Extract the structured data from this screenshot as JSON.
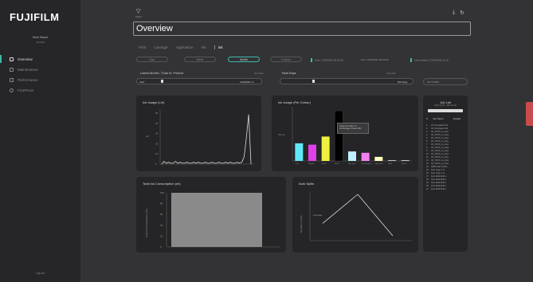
{
  "sidebar": {
    "logo": "FUJIFILM",
    "user_name": "Hemi Steam",
    "user_role": "Shortlist",
    "items": [
      {
        "label": "Overview",
        "icon": "grid-icon",
        "active": true
      },
      {
        "label": "Maintenance",
        "icon": "calendar-icon",
        "active": false
      },
      {
        "label": "Performance",
        "icon": "chart-icon",
        "active": false
      },
      {
        "label": "FUJIFILM",
        "icon": "pin-icon",
        "active": false
      }
    ],
    "logout": "Log out"
  },
  "header": {
    "filter_label": "Filters",
    "title": "Overview",
    "icons": [
      "download-icon",
      "refresh-icon"
    ]
  },
  "tabs": [
    "Print",
    "Carriage",
    "Application",
    "Ink",
    "Ink"
  ],
  "time_range": {
    "options": [
      "Day",
      "Week",
      "Month",
      "Custom"
    ],
    "selected": "Month",
    "start": "Start: 17/05/2022 00:00:00",
    "end": "End: 17/06/2022 00:00:00",
    "last_updated": "Last Updated: 17/06/2022 11:30"
  },
  "sliders": {
    "latest_label": "Latest Month / Total in: Printed",
    "latest_sub": "Set Filter",
    "latest_start": "Start",
    "latest_end": "10000000 m²",
    "total_label": "Total Days",
    "total_sub": "Set Filter",
    "total_end": "600 Days",
    "date": "04/17/2022"
  },
  "colors": {
    "accent": "#3fb8a8",
    "cyan": "#5fe8f8",
    "magenta": "#e040e8",
    "yellow": "#f0f040",
    "black": "#000000",
    "light_blue": "#c0f0ff",
    "pink": "#f080f0",
    "light_yellow": "#ffffc0",
    "side_tab": "#c94b4b"
  },
  "ink_usage": {
    "title": "Ink Usage (L/h)",
    "ylabel": "L/h",
    "yticks": [
      "60",
      "40",
      "30",
      "20",
      "10",
      "0"
    ]
  },
  "ink_per_colour": {
    "title": "Ink Usage (Per Colour)",
    "ylabel": "Ink (L)",
    "tooltip_line1": "Usage for black: 4 L",
    "tooltip_line2": "Percentage of total: 24%"
  },
  "total_ink": {
    "title": "Total Ink Consumption (ml)",
    "ylabel": "Total Ink Consumption (ml)",
    "yticks": [
      "100",
      "80",
      "60",
      "40",
      "20",
      "0"
    ]
  },
  "auto_splits": {
    "title": "Auto Splits",
    "ylabel": "Number of splits",
    "annotation": "Average"
  },
  "job_list": {
    "title": "Job List",
    "subtitle": "2022-03-08 - 2022-04-08",
    "col_num": "#",
    "col_name": "Job Name",
    "col_status": "Details",
    "rows": [
      {
        "num": "1",
        "name": "AF Corrugated Full"
      },
      {
        "num": "2",
        "name": "AF Corrugated Full"
      },
      {
        "num": "3",
        "name": "AF_CMYK_Le_blue"
      },
      {
        "num": "4",
        "name": "AF_CMYK_Le_blue"
      },
      {
        "num": "5",
        "name": "AF_CMYK_Le_blue"
      },
      {
        "num": "6",
        "name": "AF_CMYK_Le_blue"
      },
      {
        "num": "7",
        "name": "AF_CMYK_Le_blue"
      },
      {
        "num": "8",
        "name": "AF_CMYK_Le_blue"
      },
      {
        "num": "9",
        "name": "AF_CMYK_Le_blue"
      },
      {
        "num": "10",
        "name": "AF_CMYK_Le_blue"
      },
      {
        "num": "11",
        "name": "AF_CMYK_Le_blue"
      },
      {
        "num": "12",
        "name": "AF_CMYK_Le_blue"
      },
      {
        "num": "13",
        "name": "AF_CMYK_Le_blue"
      },
      {
        "num": "14",
        "name": "HMB Scaff: A Plan"
      },
      {
        "num": "15",
        "name": "Auto Layer: Lot"
      },
      {
        "num": "16",
        "name": "Auto Layer: Lot"
      },
      {
        "num": "17",
        "name": "Auto Multi-Multi L"
      },
      {
        "num": "18",
        "name": "Auto Multi-Multi L"
      },
      {
        "num": "19",
        "name": "Auto Multi-Multi L"
      },
      {
        "num": "20",
        "name": "Auto Multi-Multi L"
      },
      {
        "num": "21",
        "name": "Auto Multi-Multi L"
      }
    ]
  },
  "chart_data": [
    {
      "type": "line",
      "title": "Ink Usage (L/h)",
      "ylabel": "L/h",
      "ylim": [
        0,
        60
      ],
      "y": [
        0,
        3,
        1,
        2,
        1,
        1,
        3,
        1,
        2,
        1,
        1,
        2,
        1,
        1,
        2,
        1,
        2,
        1,
        1,
        2,
        1,
        1,
        2,
        1,
        1,
        2,
        1,
        1,
        2,
        1,
        2,
        1,
        1,
        2,
        1,
        2,
        8,
        30,
        55,
        0
      ]
    },
    {
      "type": "bar",
      "title": "Ink Usage (Per Colour)",
      "ylabel": "Ink (L)",
      "categories": [
        "Cyan",
        "Magenta",
        "Yellow",
        "Black",
        "Light Cyan",
        "Light Magenta",
        "Light Yellow",
        "White",
        "Varnish"
      ],
      "values": [
        1.3,
        1.2,
        1.8,
        3.7,
        0.7,
        0.6,
        0.3,
        0.05,
        0.05
      ],
      "ylim": [
        0,
        4
      ]
    },
    {
      "type": "bar",
      "title": "Total Ink Consumption (ml)",
      "ylabel": "Total Ink Consumption (ml)",
      "categories": [
        ""
      ],
      "values": [
        100
      ],
      "ylim": [
        0,
        100
      ]
    },
    {
      "type": "line",
      "title": "Auto Splits",
      "ylabel": "Number of splits",
      "x": [
        0,
        1,
        2
      ],
      "y": [
        0.3,
        1,
        0
      ],
      "ylim": [
        0,
        1
      ]
    }
  ]
}
